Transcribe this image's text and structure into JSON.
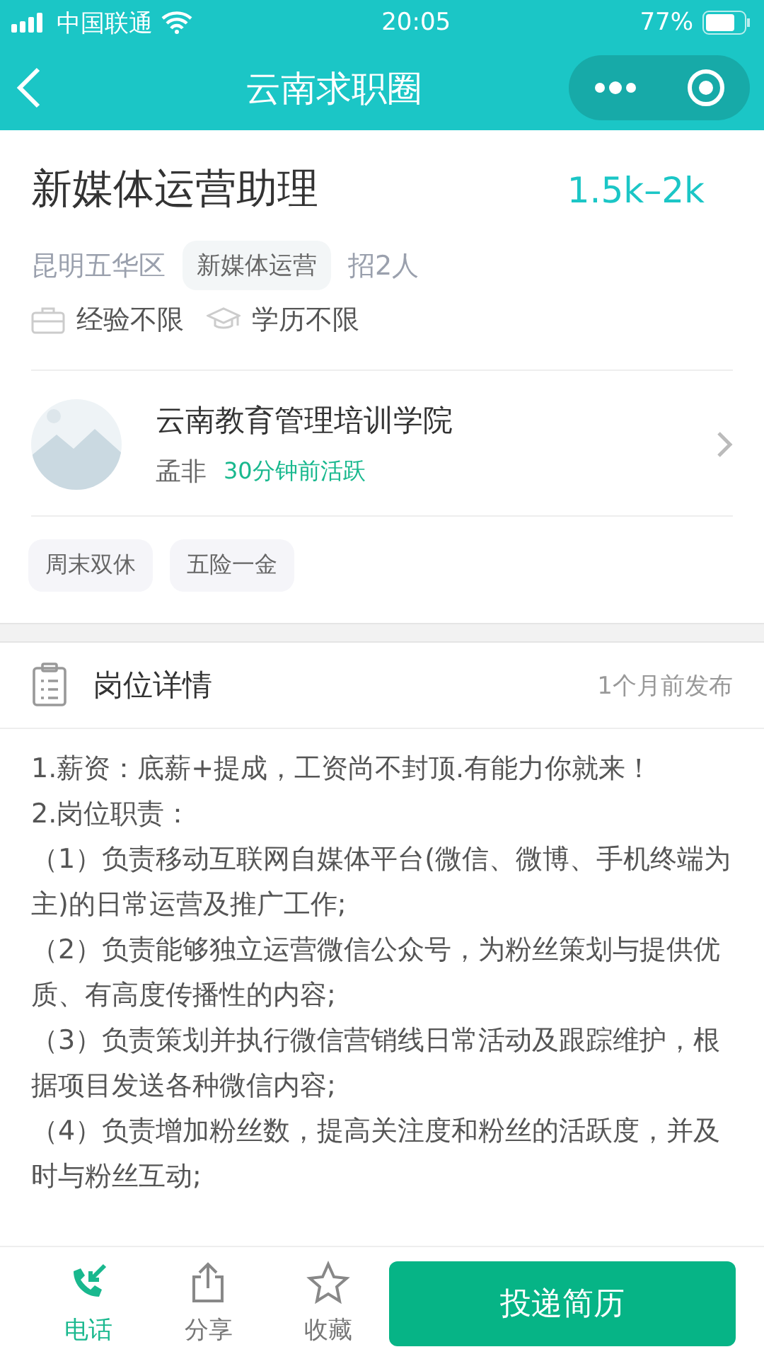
{
  "status_bar": {
    "carrier": "中国联通",
    "time": "20:05",
    "battery": "77%"
  },
  "nav": {
    "title": "云南求职圈"
  },
  "job": {
    "title": "新媒体运营助理",
    "salary": "1.5k–2k",
    "location": "昆明五华区",
    "category": "新媒体运营",
    "headcount": "招2人",
    "requirements": [
      {
        "kind": "experience",
        "text": "经验不限"
      },
      {
        "kind": "education",
        "text": "学历不限"
      }
    ]
  },
  "company": {
    "name": "云南教育管理培训学院",
    "contact": "孟非",
    "active": "30分钟前活跃",
    "benefits": [
      "周末双休",
      "五险一金"
    ]
  },
  "details": {
    "heading": "岗位详情",
    "posted": "1个月前发布",
    "paragraphs": [
      "1.薪资：底薪+提成，工资尚不封顶.有能力你就来！",
      "2.岗位职责：",
      "（1）负责移动互联网自媒体平台(微信、微博、手机终端为主)的日常运营及推广工作;",
      "（2）负责能够独立运营微信公众号，为粉丝策划与提供优质、有高度传播性的内容;",
      "（3）负责策划并执行微信营销线日常活动及跟踪维护，根据项目发送各种微信内容;",
      "（4）负责增加粉丝数，提高关注度和粉丝的活跃度，并及时与粉丝互动;"
    ]
  },
  "bottom_bar": {
    "actions": [
      {
        "kind": "phone",
        "label": "电话",
        "selected": true
      },
      {
        "kind": "share",
        "label": "分享",
        "selected": false
      },
      {
        "kind": "star",
        "label": "收藏",
        "selected": false
      }
    ],
    "apply_button": "投递简历"
  }
}
